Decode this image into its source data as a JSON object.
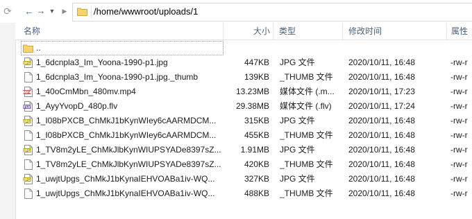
{
  "address": {
    "path": "/home/wwwroot/uploads/1"
  },
  "nav": {
    "refresh_icon": "refresh-icon",
    "back_icon": "back-arrow-icon",
    "forward_icon": "forward-arrow-icon",
    "recent_icon": "chevron-down-icon",
    "up_icon": "chevron-right-icon"
  },
  "columns": {
    "name": "名称",
    "size": "大小",
    "type": "类型",
    "modified": "修改时间",
    "attributes": "属性"
  },
  "parent": {
    "name": ".."
  },
  "files": [
    {
      "icon": "jpg",
      "name": "1_6dcnpla3_Im_Yoona-1990-p1.jpg",
      "size": "447KB",
      "type": "JPG 文件",
      "modified": "2020/10/11, 16:48",
      "attr": "-rw-r"
    },
    {
      "icon": "blank",
      "name": "1_6dcnpla3_Im_Yoona-1990-p1.jpg._thumb",
      "size": "139KB",
      "type": "_THUMB 文件",
      "modified": "2020/10/11, 16:48",
      "attr": "-rw-r"
    },
    {
      "icon": "mp4",
      "name": "1_40oCmMbn_480mv.mp4",
      "size": "13.23MB",
      "type": "媒体文件 (.m...",
      "modified": "2020/10/11, 17:23",
      "attr": "-rw-r"
    },
    {
      "icon": "flv",
      "name": "1_AyyYvopD_480p.flv",
      "size": "29.38MB",
      "type": "媒体文件 (.flv)",
      "modified": "2020/10/11, 17:24",
      "attr": "-rw-r"
    },
    {
      "icon": "jpg",
      "name": "1_I08bPXCB_ChMkJ1bKynWIey6cAARMDCM...",
      "size": "315KB",
      "type": "JPG 文件",
      "modified": "2020/10/11, 16:48",
      "attr": "-rw-r"
    },
    {
      "icon": "blank",
      "name": "1_I08bPXCB_ChMkJ1bKynWIey6cAARMDCM...",
      "size": "455KB",
      "type": "_THUMB 文件",
      "modified": "2020/10/11, 16:48",
      "attr": "-rw-r"
    },
    {
      "icon": "jpg",
      "name": "1_TV8m2yLE_ChMkJlbKynWIUPSYADe8397sZ...",
      "size": "1.91MB",
      "type": "JPG 文件",
      "modified": "2020/10/11, 16:48",
      "attr": "-rw-r"
    },
    {
      "icon": "blank",
      "name": "1_TV8m2yLE_ChMkJlbKynWIUPSYADe8397sZ...",
      "size": "420KB",
      "type": "_THUMB 文件",
      "modified": "2020/10/11, 16:48",
      "attr": "-rw-r"
    },
    {
      "icon": "jpg",
      "name": "1_uwjtUpgs_ChMkJ1bKynaIEHVOABa1iv-WQ...",
      "size": "327KB",
      "type": "JPG 文件",
      "modified": "2020/10/11, 16:48",
      "attr": "-rw-r"
    },
    {
      "icon": "blank",
      "name": "1_uwjtUpgs_ChMkJ1bKynaIEHVOABa1iv-WQ...",
      "size": "488KB",
      "type": "_THUMB 文件",
      "modified": "2020/10/11, 16:48",
      "attr": "-rw-r"
    }
  ],
  "icon_badges": {
    "jpg": "JPG",
    "mp4": "MP4",
    "flv": "FLV"
  },
  "colors": {
    "header_text": "#4c607a",
    "folder": "#f6d36b",
    "jpg_badge": "#b8a200",
    "mp4_badge": "#d9534f",
    "flv_badge": "#7b5fb9"
  }
}
